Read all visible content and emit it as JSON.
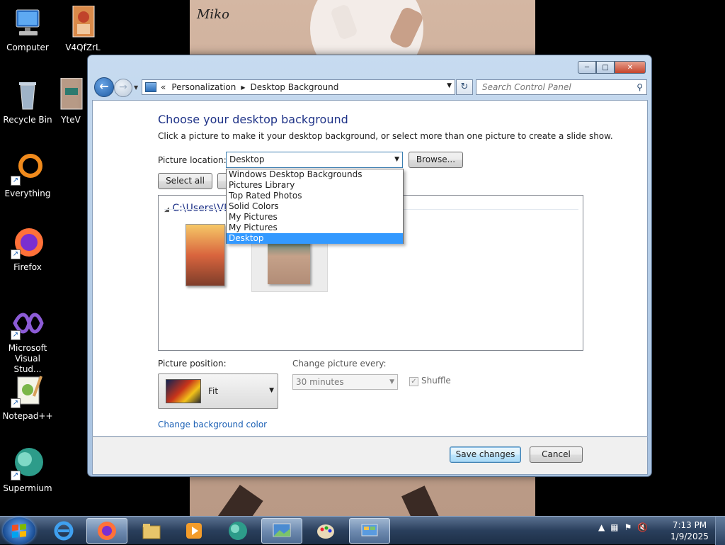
{
  "desktop": {
    "icons": [
      {
        "label": "Computer"
      },
      {
        "label": "V4QfZrL"
      },
      {
        "label": "Recycle Bin"
      },
      {
        "label": "YteV"
      },
      {
        "label": "Everything"
      },
      {
        "label": "Firefox"
      },
      {
        "label": "Microsoft Visual Stud..."
      },
      {
        "label": "Notepad++"
      },
      {
        "label": "Supermium"
      }
    ],
    "wallpaper_signature": "Miko"
  },
  "window": {
    "breadcrumb": {
      "overflow": "«",
      "items": [
        "Personalization",
        "Desktop Background"
      ]
    },
    "search_placeholder": "Search Control Panel",
    "title": "Choose your desktop background",
    "description": "Click a picture to make it your desktop background, or select more than one picture to create a slide show.",
    "picture_location": {
      "label": "Picture location:",
      "value": "Desktop",
      "options": [
        "Windows Desktop Backgrounds",
        "Pictures Library",
        "Top Rated Photos",
        "Solid Colors",
        "My Pictures",
        "My Pictures",
        "Desktop"
      ],
      "selected_index": 6
    },
    "browse_label": "Browse...",
    "select_all_label": "Select all",
    "picture_group_path": "C:\\Users\\VM",
    "picture_position": {
      "label": "Picture position:",
      "value": "Fit"
    },
    "change_every": {
      "label": "Change picture every:",
      "value": "30 minutes"
    },
    "shuffle_label": "Shuffle",
    "shuffle_checked": true,
    "change_bg_color_label": "Change background color",
    "save_label": "Save changes",
    "cancel_label": "Cancel"
  },
  "taskbar": {
    "apps": [
      "internet-explorer",
      "firefox",
      "file-explorer",
      "media-player",
      "supermium",
      "desktop-background",
      "paint",
      "control-panel"
    ],
    "time": "7:13 PM",
    "date": "1/9/2025"
  },
  "colors": {
    "link": "#1a5fb4",
    "title": "#1e3287",
    "selection": "#3399ff"
  }
}
